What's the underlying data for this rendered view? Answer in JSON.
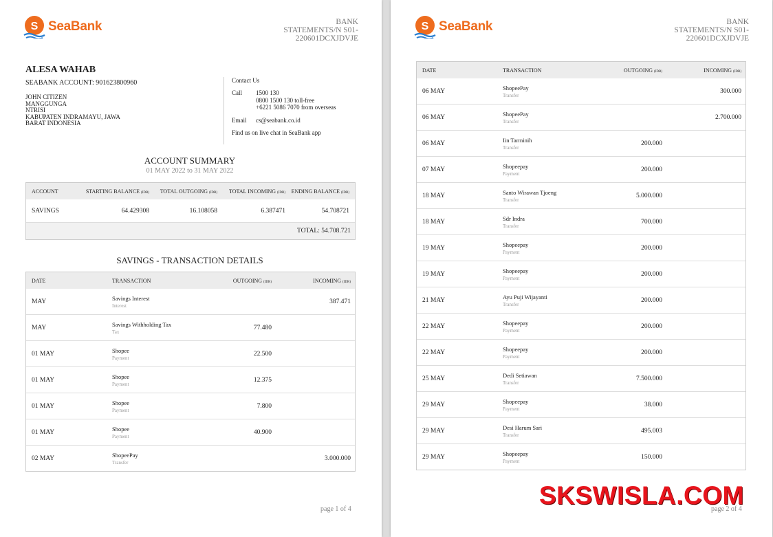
{
  "brand": {
    "name": "SeaBank",
    "accent": "#ee6c1e"
  },
  "statement_label": [
    "BANK",
    "STATEMENTS/N S01-",
    "220601DCXJDVJE"
  ],
  "customer": {
    "name": "ALESA WAHAB",
    "account_line": "SEABANK ACCOUNT: 901623800960",
    "address": [
      "JOHN CITIZEN",
      "MANGGUNGA",
      "NTRISI",
      "KABUPATEN INDRAMAYU, JAWA",
      "BARAT INDONESIA"
    ]
  },
  "contact": {
    "title": "Contact Us",
    "call_label": "Call",
    "call_lines": [
      "1500 130",
      "0800 1500 130 toll-free",
      "+6221 5086 7070 from overseas"
    ],
    "email_label": "Email",
    "email": "cs@seabank.co.id",
    "chat": "Find us on live chat in SeaBank app"
  },
  "summary": {
    "title": "ACCOUNT SUMMARY",
    "period": "01 MAY 2022 to 31 MAY 2022",
    "headers": [
      "ACCOUNT",
      "STARTING BALANCE",
      "TOTAL OUTGOING",
      "TOTAL INCOMING",
      "ENDING BALANCE"
    ],
    "unit": "(IDR)",
    "row": [
      "SAVINGS",
      "64.429308",
      "16.108058",
      "6.387471",
      "54.708721"
    ],
    "total": "TOTAL: 54.708.721"
  },
  "details": {
    "title": "SAVINGS - TRANSACTION DETAILS",
    "headers": [
      "DATE",
      "TRANSACTION",
      "OUTGOING",
      "INCOMING"
    ],
    "unit": "(IDR)",
    "page1_rows": [
      {
        "date": "MAY",
        "name": "Savings Interest",
        "type": "Interest",
        "out": "",
        "in": "387.471"
      },
      {
        "date": "MAY",
        "name": "Savings Withholding Tax",
        "type": "Tax",
        "out": "77.480",
        "in": ""
      },
      {
        "date": "01 MAY",
        "name": "Shopee",
        "type": "Payment",
        "out": "22.500",
        "in": ""
      },
      {
        "date": "01 MAY",
        "name": "Shopee",
        "type": "Payment",
        "out": "12.375",
        "in": ""
      },
      {
        "date": "01 MAY",
        "name": "Shopee",
        "type": "Payment",
        "out": "7.800",
        "in": ""
      },
      {
        "date": "01 MAY",
        "name": "Shopee",
        "type": "Payment",
        "out": "40.900",
        "in": ""
      },
      {
        "date": "02 MAY",
        "name": "ShopeePay",
        "type": "Transfer",
        "out": "",
        "in": "3.000.000"
      }
    ],
    "page2_rows": [
      {
        "date": "06 MAY",
        "name": "ShopeePay",
        "type": "Transfer",
        "out": "",
        "in": "300.000"
      },
      {
        "date": "06 MAY",
        "name": "ShopeePay",
        "type": "Transfer",
        "out": "",
        "in": "2.700.000"
      },
      {
        "date": "06 MAY",
        "name": "Iin Tarminih",
        "type": "Transfer",
        "out": "200.000",
        "in": ""
      },
      {
        "date": "07 MAY",
        "name": "Shopeepay",
        "type": "Payment",
        "out": "200.000",
        "in": ""
      },
      {
        "date": "18 MAY",
        "name": "Santo Wirawan Tjoeng",
        "type": "Transfer",
        "out": "5.000.000",
        "in": ""
      },
      {
        "date": "18 MAY",
        "name": "Sdr Indra",
        "type": "Transfer",
        "out": "700.000",
        "in": ""
      },
      {
        "date": "19 MAY",
        "name": "Shopeepay",
        "type": "Payment",
        "out": "200.000",
        "in": ""
      },
      {
        "date": "19 MAY",
        "name": "Shopeepay",
        "type": "Payment",
        "out": "200.000",
        "in": ""
      },
      {
        "date": "21 MAY",
        "name": "Ayu Puji Wijayanti",
        "type": "Transfer",
        "out": "200.000",
        "in": ""
      },
      {
        "date": "22 MAY",
        "name": "Shopeepay",
        "type": "Payment",
        "out": "200.000",
        "in": ""
      },
      {
        "date": "22 MAY",
        "name": "Shopeepay",
        "type": "Payment",
        "out": "200.000",
        "in": ""
      },
      {
        "date": "25 MAY",
        "name": "Dedi Setiawan",
        "type": "Transfer",
        "out": "7.500.000",
        "in": ""
      },
      {
        "date": "29 MAY",
        "name": "Shopeepay",
        "type": "Payment",
        "out": "38.000",
        "in": ""
      },
      {
        "date": "29 MAY",
        "name": "Desi Harum Sari",
        "type": "Transfer",
        "out": "495.003",
        "in": ""
      },
      {
        "date": "29 MAY",
        "name": "Shopeepay",
        "type": "Payment",
        "out": "150.000",
        "in": ""
      }
    ]
  },
  "pages": [
    "page 1 of 4",
    "page 2 of 4"
  ],
  "watermark": "SKSWISLA.COM"
}
